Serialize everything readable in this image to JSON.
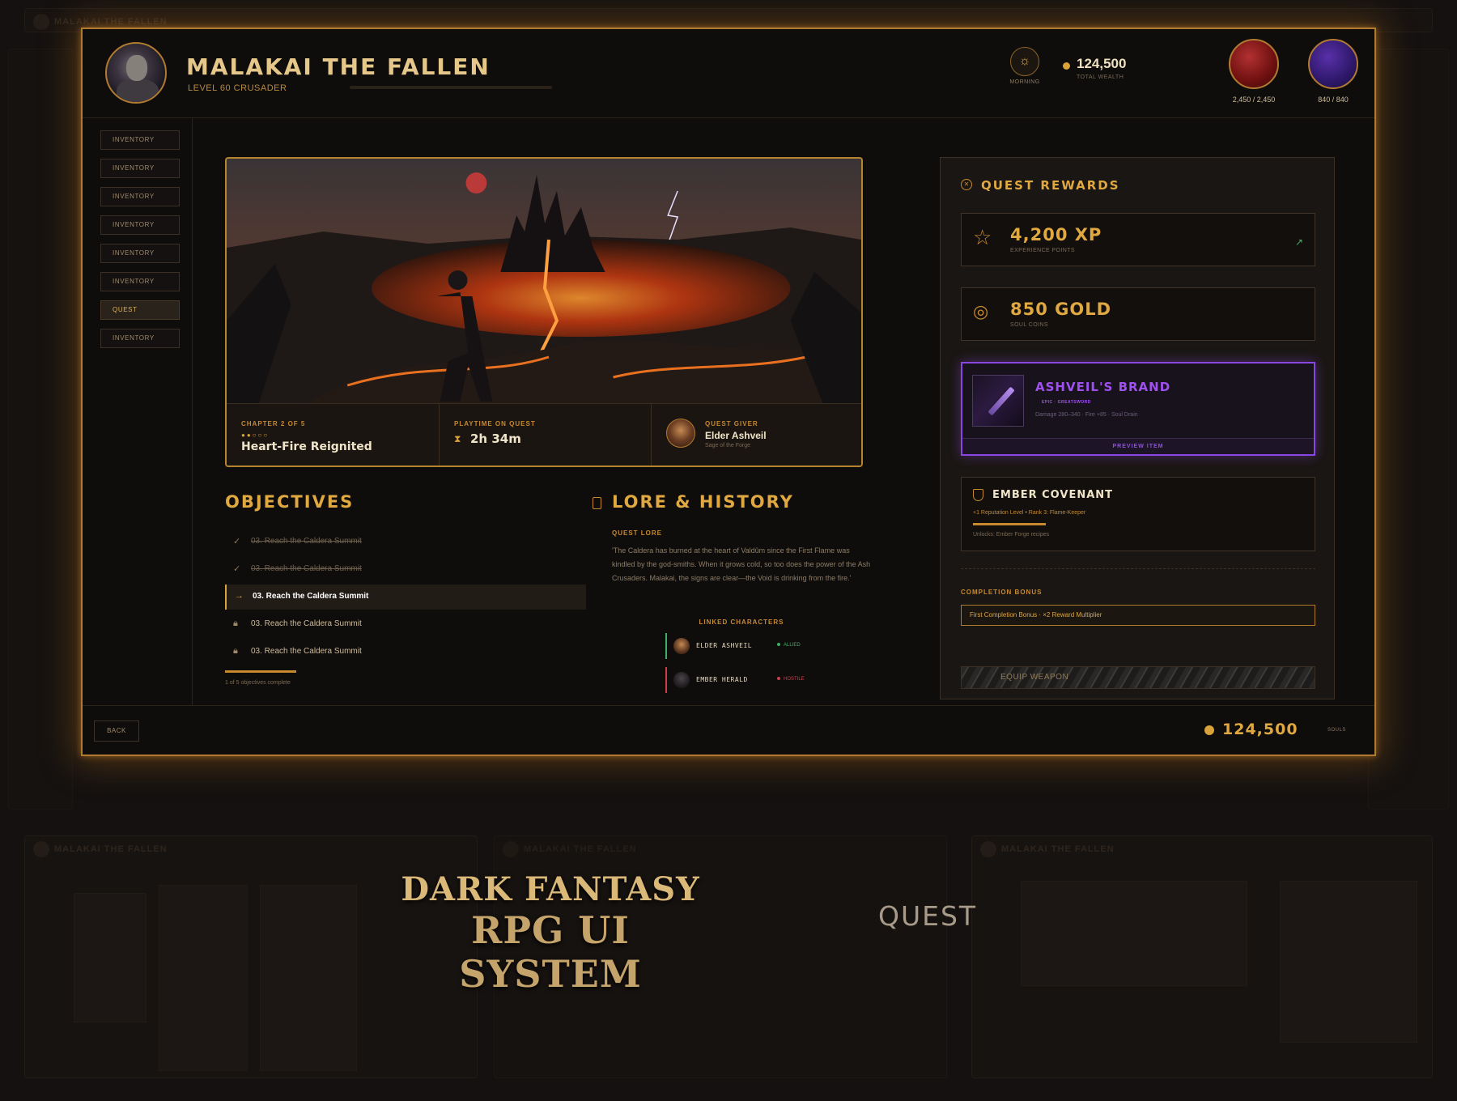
{
  "header": {
    "name": "MALAKAI THE FALLEN",
    "class": "LEVEL 60 CRUSADER",
    "time_of_day": "MORNING",
    "wealth_value": "124,500",
    "wealth_label": "TOTAL WEALTH",
    "hp": "2,450 / 2,450",
    "mp": "840 / 840"
  },
  "sidebar": {
    "items": [
      {
        "label": "INVENTORY"
      },
      {
        "label": "INVENTORY"
      },
      {
        "label": "INVENTORY"
      },
      {
        "label": "INVENTORY"
      },
      {
        "label": "INVENTORY"
      },
      {
        "label": "INVENTORY"
      },
      {
        "label": "QUEST",
        "active": true
      },
      {
        "label": "INVENTORY"
      }
    ]
  },
  "hero": {
    "chapter_label": "CHAPTER 2 OF 5",
    "chapter_title": "Heart-Fire Reignited",
    "playtime_label": "PLAYTIME ON QUEST",
    "playtime_value": "2h 34m",
    "giver_label": "QUEST GIVER",
    "giver_name": "Elder Ashveil",
    "giver_sub": "Sage of the Forge"
  },
  "objectives": {
    "title": "OBJECTIVES",
    "items": [
      {
        "text": "03. Reach the Caldera Summit",
        "state": "done"
      },
      {
        "text": "03. Reach the Caldera Summit",
        "state": "done"
      },
      {
        "text": "03. Reach the Caldera Summit",
        "state": "current"
      },
      {
        "text": "03. Reach the Caldera Summit",
        "state": "locked"
      },
      {
        "text": "03. Reach the Caldera Summit",
        "state": "locked"
      }
    ],
    "progress_text": "1 of 5 objectives complete"
  },
  "lore": {
    "title": "LORE & HISTORY",
    "label": "QUEST LORE",
    "text": "'The Caldera has burned at the heart of Valdûm since the First Flame was kindled by the god-smiths. When it grows cold, so too does the power of the Ash Crusaders. Malakai, the signs are clear—the Void is drinking from the fire.'",
    "linked_label": "LINKED CHARACTERS",
    "characters": [
      {
        "name": "ELDER ASHVEIL",
        "status": "ALLIED",
        "color": "#3fae66"
      },
      {
        "name": "EMBER HERALD",
        "status": "HOSTILE",
        "color": "#c8404a"
      }
    ]
  },
  "rewards": {
    "title": "QUEST REWARDS",
    "xp_value": "4,200 XP",
    "xp_label": "EXPERIENCE POINTS",
    "gold_value": "850 GOLD",
    "gold_label": "SOUL COINS",
    "item_name": "ASHVEIL'S BRAND",
    "item_tag": "EPIC · GREATSWORD",
    "item_stats": "Damage 280–340 · Fire +85 · Soul Drain",
    "item_button": "PREVIEW ITEM",
    "faction_name": "EMBER COVENANT",
    "faction_rep": "+1 Reputation Level • Rank 3: Flame-Keeper",
    "faction_unlock": "Unlocks: Ember Forge recipes",
    "bonus_label": "COMPLETION BONUS",
    "bonus_text": "First Completion Bonus · ×2 Reward Multiplier",
    "equip_button": "EQUIP WEAPON"
  },
  "footer": {
    "back": "BACK",
    "souls_value": "124,500",
    "souls_label": "SOULS"
  },
  "branding": {
    "line1": "DARK FANTASY",
    "line2": "RPG UI SYSTEM",
    "screen": "QUEST"
  },
  "ghost_titles": [
    "MALAKAI THE FALLEN",
    "MALAKAI THE FALLEN",
    "MALAKAI THE FALLEN"
  ],
  "colors": {
    "accent": "#e0a840",
    "epic": "#a050f0",
    "allied": "#3fae66",
    "hostile": "#c8404a"
  }
}
